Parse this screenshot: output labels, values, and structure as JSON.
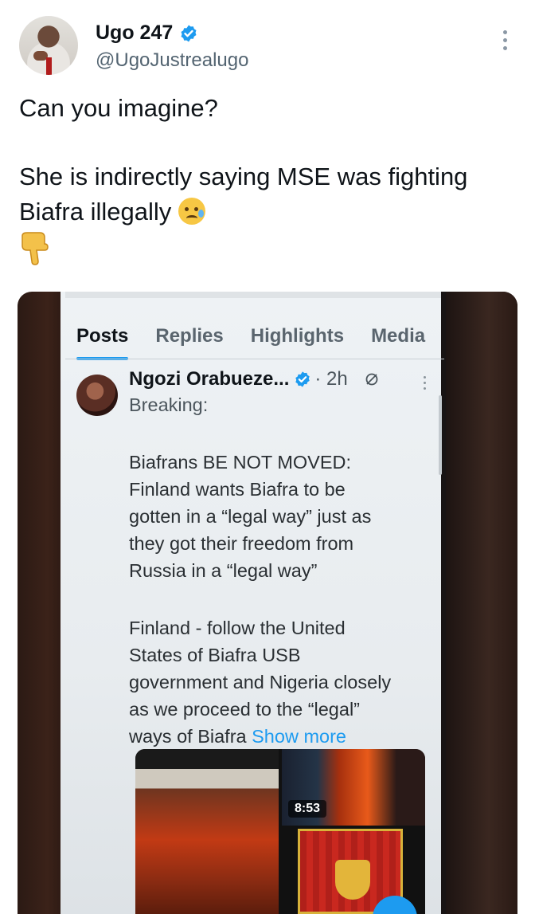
{
  "author": {
    "display_name": "Ugo 247",
    "handle": "@UgoJustrealugo",
    "verified": true
  },
  "tweet": {
    "line1": "Can you imagine?",
    "line2": "She is indirectly saying MSE was fighting",
    "line3": "Biafra illegally",
    "emoji_line3": "crying-face-icon",
    "emoji_line4": "backhand-index-pointing-down-icon"
  },
  "embedded_screenshot": {
    "tabs": [
      "Posts",
      "Replies",
      "Highlights",
      "Media"
    ],
    "active_tab": "Posts",
    "post": {
      "author_name": "Ngozi Orabueze...",
      "time": "· 2h",
      "text_breaking": "Breaking:",
      "paragraph1": [
        "Biafrans BE NOT MOVED:",
        "Finland  wants Biafra to be",
        "gotten in a “legal way” just as",
        "they got their freedom from",
        "Russia in a “legal way”"
      ],
      "paragraph2": [
        "Finland - follow the United",
        "States of Biafra USB",
        "government and Nigeria closely",
        "as we proceed to the “legal”",
        "ways of Biafra"
      ],
      "show_more": "Show more",
      "video_duration": "8:53"
    }
  },
  "colors": {
    "accent": "#1d9bf0",
    "text": "#0f1419",
    "muted": "#536471"
  }
}
